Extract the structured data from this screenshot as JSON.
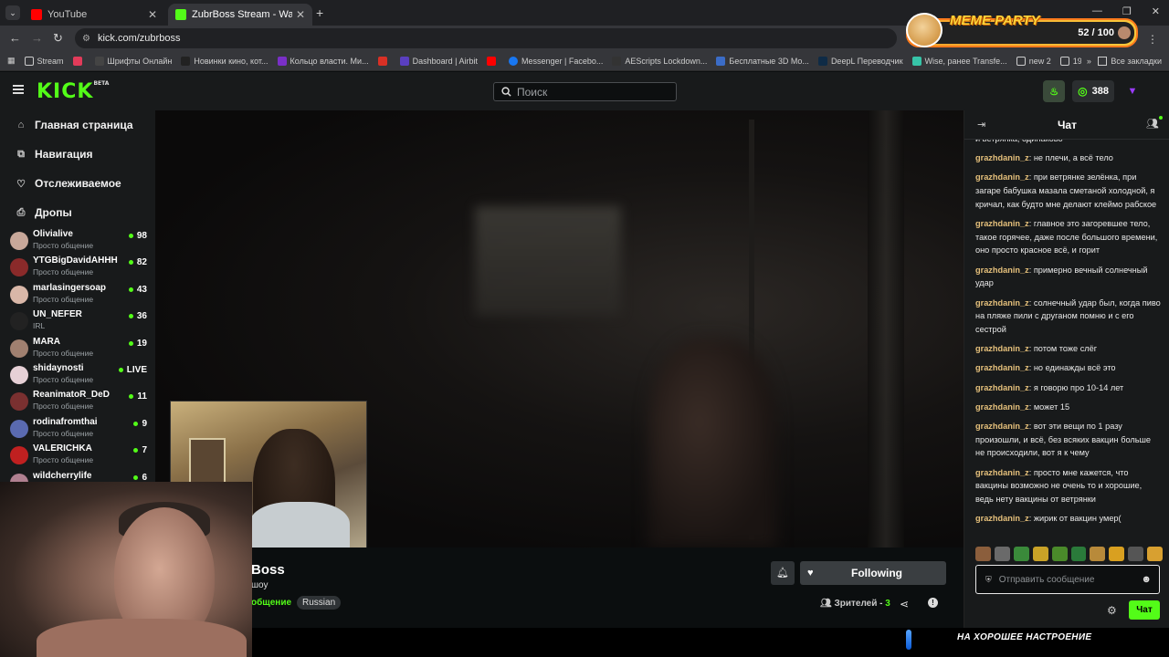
{
  "browser": {
    "tabs": [
      {
        "title": "YouTube",
        "color": "#ff0000"
      },
      {
        "title": "ZubrBoss Stream - Watch L",
        "color": "#53fc18"
      }
    ],
    "url": "kick.com/zubrboss",
    "bookmarks": [
      {
        "label": "Stream",
        "type": "folder"
      },
      {
        "label": "",
        "type": "icon",
        "color": "#e23b5a"
      },
      {
        "label": "Шрифты Онлайн",
        "type": "site",
        "color": "#444"
      },
      {
        "label": "Новинки кино, кот...",
        "type": "site",
        "color": "#222"
      },
      {
        "label": "Кольцо власти. Ми...",
        "type": "site",
        "color": "#7a2fc7"
      },
      {
        "label": "",
        "type": "icon",
        "color": "#d93025"
      },
      {
        "label": "Dashboard | Airbit",
        "type": "site",
        "color": "#5a3fc0"
      },
      {
        "label": "",
        "type": "icon",
        "color": "#ff0000"
      },
      {
        "label": "Messenger | Facebo...",
        "type": "site",
        "color": "#1877f2"
      },
      {
        "label": "AEScripts Lockdown...",
        "type": "site",
        "color": "#333"
      },
      {
        "label": "Бесплатные 3D Мо...",
        "type": "site",
        "color": "#3b6cc7"
      },
      {
        "label": "DeepL Переводчик",
        "type": "site",
        "color": "#0f2b46"
      },
      {
        "label": "Wise, ранее Transfe...",
        "type": "site",
        "color": "#37c4a8"
      },
      {
        "label": "new 2",
        "type": "folder"
      },
      {
        "label": "19",
        "type": "folder"
      }
    ],
    "all_bookmarks": "Все закладки"
  },
  "overlay": {
    "meme_title": "MEME PARTY",
    "meme_count": "52 / 100",
    "banner": "НА ХОРОШЕЕ НАСТРОЕНИЕ"
  },
  "header": {
    "logo": "KICK",
    "logo_tag": "BETA",
    "search_placeholder": "Поиск",
    "points": "388"
  },
  "sidebar": {
    "nav": [
      {
        "label": "Главная страница",
        "icon": "home-icon",
        "glyph": "⌂"
      },
      {
        "label": "Навигация",
        "icon": "browse-icon",
        "glyph": "⧉"
      },
      {
        "label": "Отслеживаемое",
        "icon": "heart-icon",
        "glyph": "♡"
      },
      {
        "label": "Дропы",
        "icon": "gift-icon",
        "glyph": "⎙"
      }
    ],
    "channels": [
      {
        "name": "Olivialive",
        "category": "Просто общение",
        "viewers": "98",
        "color": "#c8a89a"
      },
      {
        "name": "YTGBigDavidAHHH",
        "category": "Просто общение",
        "viewers": "82",
        "color": "#8a2a2a"
      },
      {
        "name": "marlasingersoap",
        "category": "Просто общение",
        "viewers": "43",
        "color": "#d9b7a8"
      },
      {
        "name": "UN_NEFER",
        "category": "IRL",
        "viewers": "36",
        "color": "#222"
      },
      {
        "name": "MARA",
        "category": "Просто общение",
        "viewers": "19",
        "color": "#a08070"
      },
      {
        "name": "shidaynosti",
        "category": "Просто общение",
        "viewers": "LIVE",
        "color": "#e6d0d6"
      },
      {
        "name": "ReanimatoR_DeD",
        "category": "Просто общение",
        "viewers": "11",
        "color": "#7a3030"
      },
      {
        "name": "rodinafromthai",
        "category": "Просто общение",
        "viewers": "9",
        "color": "#5a6ab0"
      },
      {
        "name": "VALERICHKA",
        "category": "Просто общение",
        "viewers": "7",
        "color": "#c02020"
      },
      {
        "name": "wildcherrylife",
        "category": "",
        "viewers": "6",
        "color": "#b08090"
      }
    ]
  },
  "stream": {
    "name": "Boss",
    "title": "шоу",
    "category": "общение",
    "language": "Russian",
    "follow_label": "Following",
    "viewers_label": "Зрителей",
    "viewers_count": "3"
  },
  "chat": {
    "title": "Чат",
    "messages": [
      {
        "user": "",
        "text": "и ветрянка, одинаково"
      },
      {
        "user": "grazhdanin_z",
        "text": "не плечи, а всё тело"
      },
      {
        "user": "grazhdanin_z",
        "text": "при ветрянке зелёнка, при загаре бабушка мазала сметаной холодной, я кричал, как будто мне делают клеймо рабское"
      },
      {
        "user": "grazhdanin_z",
        "text": "главное это загоревшее тело, такое горячее, даже после большого времени, оно просто красное всё, и горит"
      },
      {
        "user": "grazhdanin_z",
        "text": "примерно вечный солнечный удар"
      },
      {
        "user": "grazhdanin_z",
        "text": "солнечный удар был, когда пиво на пляже пили с друганом помню и с его сестрой"
      },
      {
        "user": "grazhdanin_z",
        "text": "потом тоже слёг"
      },
      {
        "user": "grazhdanin_z",
        "text": "но единажды всё это"
      },
      {
        "user": "grazhdanin_z",
        "text": "я говорю про 10-14 лет"
      },
      {
        "user": "grazhdanin_z",
        "text": "может 15"
      },
      {
        "user": "grazhdanin_z",
        "text": "вот эти вещи по 1 разу произошли, и всё, без всяких вакцин больше не происходили, вот я к чему"
      },
      {
        "user": "grazhdanin_z",
        "text": "просто мне кажется, что вакцины возможно не очень то и хорошие, ведь нету вакцины от ветрянки"
      },
      {
        "user": "grazhdanin_z",
        "text": "жирик от вакцин умер("
      }
    ],
    "emote_colors": [
      "#8b5e3c",
      "#6a6a6a",
      "#3a8a3a",
      "#c9a227",
      "#4a8a2a",
      "#2a7a3a",
      "#b88a3a",
      "#d9a020",
      "#555",
      "#d8a030"
    ],
    "input_placeholder": "Отправить сообщение",
    "send_label": "Чат"
  }
}
